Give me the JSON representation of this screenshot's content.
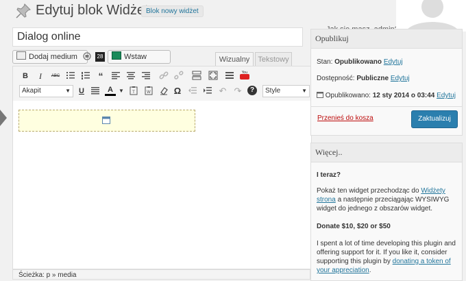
{
  "header": {
    "title": "Edytuj blok Widżet",
    "new_button": "Blok nowy widżet",
    "howdy": "Jak się masz, admin?"
  },
  "post": {
    "title_value": "Dialog online"
  },
  "media": {
    "add_media": "Dodaj medium",
    "counter": "28",
    "insert_show": "Wstaw pokaz"
  },
  "tabs": {
    "visual": "Wizualny",
    "text": "Tekstowy"
  },
  "toolbar": {
    "format_selected": "Akapit",
    "style_selected": "Style",
    "bold": "B",
    "italic": "I",
    "strike": "ABC",
    "underline": "U",
    "color": "A",
    "omega": "Ω",
    "help": "?"
  },
  "editor": {
    "path_label": "Ścieżka: p » media"
  },
  "publish": {
    "title": "Opublikuj",
    "status_label": "Stan:",
    "status_value": "Opublikowano",
    "edit_status": "Edytuj",
    "visibility_label": "Dostępność:",
    "visibility_value": "Publiczne",
    "edit_visibility": "Edytuj",
    "published_label": "Opublikowano:",
    "published_value": "12 sty 2014 o 03:44",
    "edit_date": "Edytuj",
    "trash": "Przenieś do kosza",
    "update": "Zaktualizuj"
  },
  "more": {
    "title": "Więcej..",
    "heading1": "I teraz?",
    "para1_pre": "Pokaż ten widget przechodząc do",
    "para1_link": "Widżety strona",
    "para1_post": "a następnie przeciągając WYSIWYG widget do jednego z obszarów widget.",
    "heading2": "Donate $10, $20 or $50",
    "para2_pre": "I spent a lot of time developing this plugin and offering support for it. If you like it, consider supporting this plugin by",
    "para2_link": "donating a token of your appreciation",
    "para2_post": "."
  },
  "icons": [
    "pin-icon",
    "media-icon",
    "shortcode-icon",
    "slideshow-icon",
    "bullet-list-icon",
    "numbered-list-icon",
    "blockquote-icon",
    "align-left-icon",
    "align-center-icon",
    "align-right-icon",
    "link-icon",
    "unlink-icon",
    "more-tag-icon",
    "fullscreen-icon",
    "kitchen-sink-icon",
    "youtube-icon",
    "justify-icon",
    "paste-text-icon",
    "paste-word-icon",
    "clear-format-icon",
    "indent-icon",
    "outdent-icon",
    "undo-icon",
    "redo-icon",
    "help-icon",
    "calendar-icon",
    "widget-placeholder-icon"
  ],
  "colors": {
    "accent": "#21759b",
    "update_button": "#2b7fae",
    "trash": "#bc0b0b",
    "placeholder_bg": "#ffffe0"
  }
}
